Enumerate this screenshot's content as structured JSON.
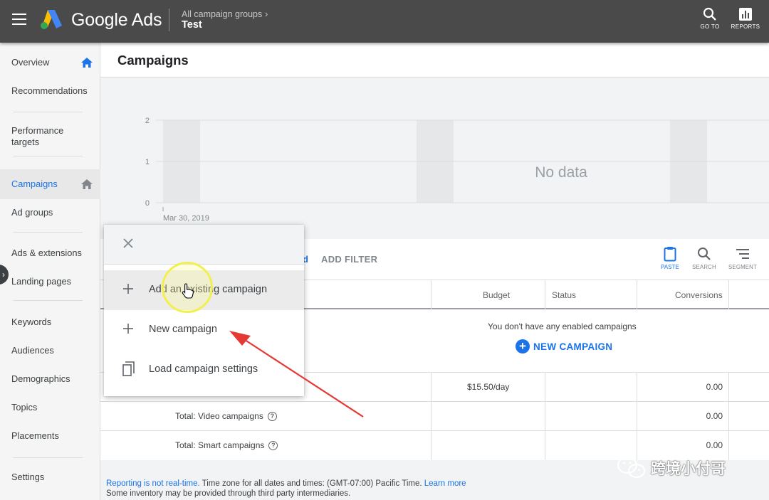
{
  "app": {
    "brand": "Google Ads",
    "breadcrumb_parent": "All campaign groups",
    "breadcrumb_chevron": "›",
    "breadcrumb_current": "Test",
    "actions": [
      {
        "label": "GO TO",
        "icon": "search-icon"
      },
      {
        "label": "REPORTS",
        "icon": "reports-icon"
      }
    ]
  },
  "sidebar": {
    "items": [
      {
        "label": "Overview",
        "icon": "home-icon"
      },
      {
        "label": "Recommendations"
      },
      {
        "label": "Performance targets"
      },
      {
        "label": "Campaigns",
        "icon": "home-icon",
        "active": true
      },
      {
        "label": "Ad groups"
      },
      {
        "label": "Ads & extensions"
      },
      {
        "label": "Landing pages"
      },
      {
        "label": "Keywords"
      },
      {
        "label": "Audiences"
      },
      {
        "label": "Demographics"
      },
      {
        "label": "Topics"
      },
      {
        "label": "Placements"
      },
      {
        "label": "Settings"
      }
    ]
  },
  "page": {
    "title": "Campaigns"
  },
  "chart_data": {
    "type": "bar",
    "y_ticks": [
      "0",
      "1",
      "2"
    ],
    "ylim": [
      0,
      2
    ],
    "x_start_label": "Mar 30, 2019",
    "no_data_label": "No data",
    "grid": true
  },
  "toolbar": {
    "link_fragment": "d",
    "add_filter": "ADD FILTER",
    "tools": [
      {
        "label": "PASTE",
        "icon": "clipboard-icon"
      },
      {
        "label": "SEARCH",
        "icon": "search-icon"
      },
      {
        "label": "SEGMENT",
        "icon": "segment-icon"
      }
    ]
  },
  "table": {
    "columns": [
      "Budget",
      "Status",
      "Conversions"
    ],
    "empty_message": "You don't have any enabled campaigns",
    "new_campaign_label": "NEW CAMPAIGN",
    "rows": [
      {
        "label": "",
        "budget": "$15.50/day",
        "conversions": "0.00"
      },
      {
        "label": "Total: Video campaigns",
        "budget": "",
        "conversions": "0.00"
      },
      {
        "label": "Total: Smart campaigns",
        "budget": "",
        "conversions": "0.00"
      }
    ]
  },
  "footer": {
    "realtime_link": "Reporting is not real-time.",
    "timezone": " Time zone for all dates and times: (GMT-07:00) Pacific Time. ",
    "learn_more": "Learn more",
    "line2": "Some inventory may be provided through third party intermediaries."
  },
  "menu": {
    "items": [
      {
        "label": "Add an existing campaign",
        "icon": "plus-icon",
        "hover": true
      },
      {
        "label": "New campaign",
        "icon": "plus-icon"
      },
      {
        "label": "Load campaign settings",
        "icon": "copy-icon"
      }
    ]
  },
  "watermark": {
    "text": "跨境小付哥"
  },
  "colors": {
    "topbar": "#4a4a4a",
    "accent": "#1a73e8",
    "arrow": "#e53935",
    "highlight": "#f2ef50"
  }
}
